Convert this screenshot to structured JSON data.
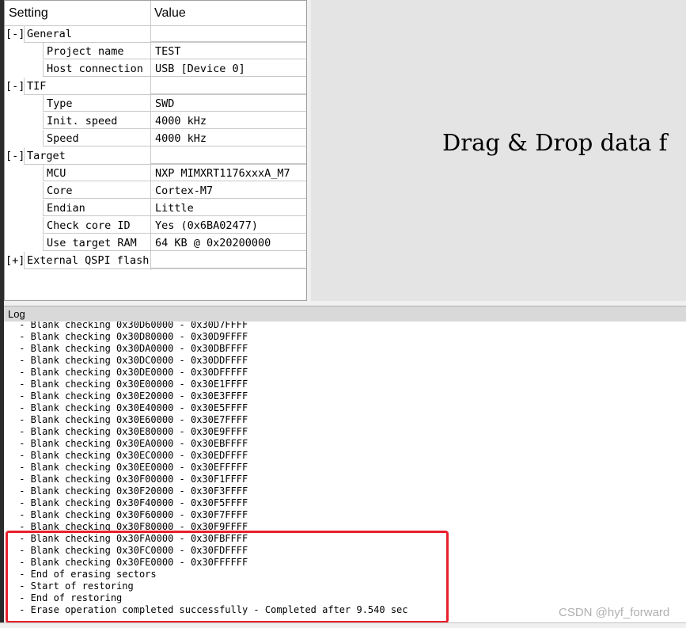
{
  "settings": {
    "header_setting": "Setting",
    "header_value": "Value",
    "rows": [
      {
        "kind": "group",
        "bracket": "[-]",
        "label": "General"
      },
      {
        "kind": "item",
        "label": "Project name",
        "value": "TEST"
      },
      {
        "kind": "item",
        "label": "Host connection",
        "value": "USB [Device 0]"
      },
      {
        "kind": "group",
        "bracket": "[-]",
        "label": "TIF"
      },
      {
        "kind": "item",
        "label": "Type",
        "value": "SWD"
      },
      {
        "kind": "item",
        "label": "Init. speed",
        "value": "4000 kHz"
      },
      {
        "kind": "item",
        "label": "Speed",
        "value": "4000 kHz"
      },
      {
        "kind": "group",
        "bracket": "[-]",
        "label": "Target"
      },
      {
        "kind": "item",
        "label": "MCU",
        "value": "NXP MIMXRT1176xxxA_M7"
      },
      {
        "kind": "item",
        "label": "Core",
        "value": "Cortex-M7"
      },
      {
        "kind": "item",
        "label": "Endian",
        "value": "Little"
      },
      {
        "kind": "item",
        "label": "Check core ID",
        "value": "Yes (0x6BA02477)"
      },
      {
        "kind": "item",
        "label": "Use target RAM",
        "value": "64 KB @ 0x20200000"
      },
      {
        "kind": "group",
        "bracket": "[+]",
        "label": "External QSPI flash"
      }
    ]
  },
  "drop_area": {
    "text": "Drag & Drop data f"
  },
  "log": {
    "title": "Log",
    "lines": [
      " - Blank checking 0x30D60000 - 0x30D7FFFF",
      " - Blank checking 0x30D80000 - 0x30D9FFFF",
      " - Blank checking 0x30DA0000 - 0x30DBFFFF",
      " - Blank checking 0x30DC0000 - 0x30DDFFFF",
      " - Blank checking 0x30DE0000 - 0x30DFFFFF",
      " - Blank checking 0x30E00000 - 0x30E1FFFF",
      " - Blank checking 0x30E20000 - 0x30E3FFFF",
      " - Blank checking 0x30E40000 - 0x30E5FFFF",
      " - Blank checking 0x30E60000 - 0x30E7FFFF",
      " - Blank checking 0x30E80000 - 0x30E9FFFF",
      " - Blank checking 0x30EA0000 - 0x30EBFFFF",
      " - Blank checking 0x30EC0000 - 0x30EDFFFF",
      " - Blank checking 0x30EE0000 - 0x30EFFFFF",
      " - Blank checking 0x30F00000 - 0x30F1FFFF",
      " - Blank checking 0x30F20000 - 0x30F3FFFF",
      " - Blank checking 0x30F40000 - 0x30F5FFFF",
      " - Blank checking 0x30F60000 - 0x30F7FFFF",
      " - Blank checking 0x30F80000 - 0x30F9FFFF",
      " - Blank checking 0x30FA0000 - 0x30FBFFFF",
      " - Blank checking 0x30FC0000 - 0x30FDFFFF",
      " - Blank checking 0x30FE0000 - 0x30FFFFFF",
      " - End of erasing sectors",
      " - Start of restoring",
      " - End of restoring",
      " - Erase operation completed successfully - Completed after 9.540 sec"
    ]
  },
  "watermark": "CSDN @hyf_forward",
  "colors": {
    "highlight": "#e8202a",
    "drop_bg": "#e4e4e4"
  }
}
